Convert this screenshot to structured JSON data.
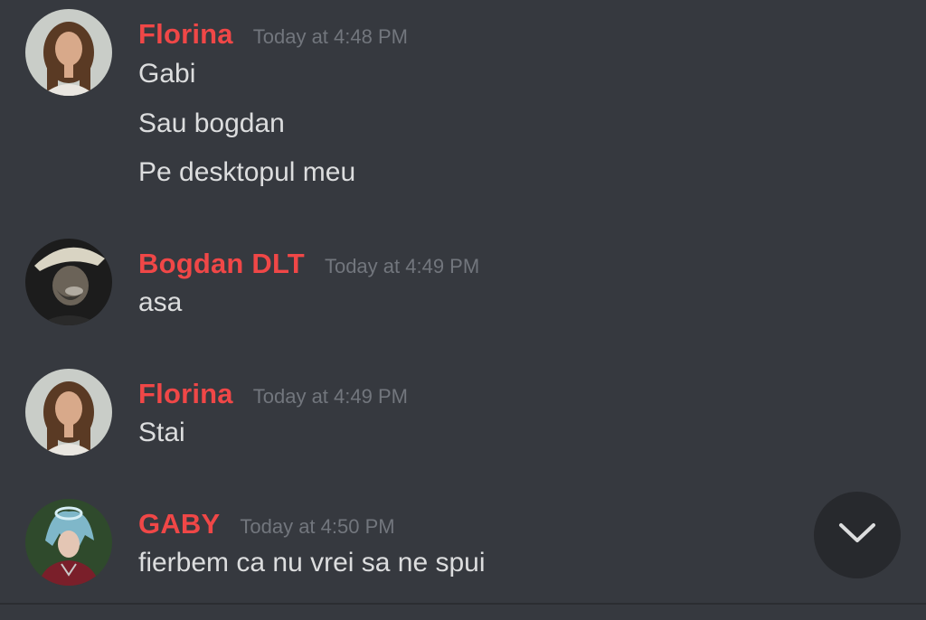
{
  "messages": [
    {
      "author": "Florina",
      "timestamp": "Today at 4:48 PM",
      "avatar": "woman-portrait-avatar",
      "lines": [
        "Gabi",
        "Sau bogdan",
        "Pe desktopul meu"
      ]
    },
    {
      "author": "Bogdan DLT",
      "timestamp": "Today at 4:49 PM",
      "avatar": "man-hat-smoke-avatar",
      "lines": [
        "asa"
      ]
    },
    {
      "author": "Florina",
      "timestamp": "Today at 4:49 PM",
      "avatar": "woman-portrait-avatar",
      "lines": [
        "Stai"
      ]
    },
    {
      "author": "GABY",
      "timestamp": "Today at 4:50 PM",
      "avatar": "anime-character-avatar",
      "lines": [
        "fierbem ca nu vrei sa ne spui"
      ]
    }
  ],
  "jump_button": {
    "icon": "chevron-down-icon"
  },
  "colors": {
    "background": "#36393f",
    "author": "#f04747",
    "timestamp": "#72767d",
    "text": "#dcddde",
    "jump_button": "#27292d"
  }
}
